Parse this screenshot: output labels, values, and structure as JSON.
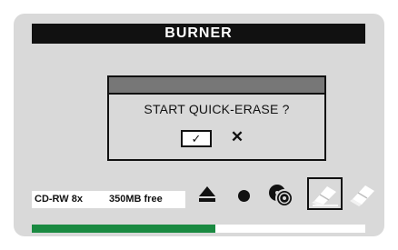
{
  "app": {
    "title": "BURNER"
  },
  "dialog": {
    "message": "START QUICK-ERASE ?",
    "ok_glyph": "✓",
    "cancel_glyph": "✕"
  },
  "status": {
    "media": "CD-RW 8x",
    "free_space": "350MB free"
  },
  "toolbar": {
    "icons": [
      "eject-icon",
      "record-icon",
      "copy-disc-icon",
      "quick-erase-icon",
      "full-erase-icon"
    ],
    "active": "quick-erase-icon"
  },
  "progress": {
    "fraction": 0.55,
    "color": "#1a8a41"
  },
  "colors": {
    "panel": "#d9d9d9",
    "title_bg": "#111111",
    "dialog_bar": "#777777"
  }
}
